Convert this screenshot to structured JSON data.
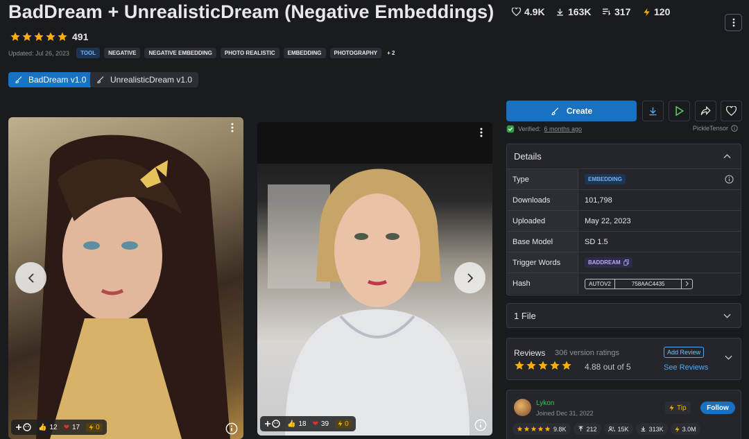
{
  "header": {
    "title": "BadDream + UnrealisticDream (Negative Embeddings)",
    "stats": [
      {
        "icon": "heart-icon",
        "value": "4.9K"
      },
      {
        "icon": "download-icon",
        "value": "163K"
      },
      {
        "icon": "bookmark-list-icon",
        "value": "317"
      },
      {
        "icon": "lightning-icon",
        "value": "120"
      }
    ],
    "rating_count": "491",
    "rating_stars": 5,
    "updated": "Updated: Jul 26, 2023",
    "tags": [
      "TOOL",
      "NEGATIVE",
      "NEGATIVE EMBEDDING",
      "PHOTO REALISTIC",
      "EMBEDDING",
      "PHOTOGRAPHY"
    ],
    "more_tags": "+ 2"
  },
  "versions": [
    {
      "label": "BadDream v1.0",
      "active": true
    },
    {
      "label": "UnrealisticDream v1.0",
      "active": false
    }
  ],
  "gallery": [
    {
      "likes": "12",
      "hearts": "17",
      "tips": "0"
    },
    {
      "likes": "18",
      "hearts": "39",
      "tips": "0"
    }
  ],
  "sidebar": {
    "create_label": "Create",
    "verified_prefix": "Verified:",
    "verified_when": "6 months ago",
    "author_tag": "PickleTensor",
    "details": {
      "title": "Details",
      "rows": [
        {
          "key": "Type",
          "value": "EMBEDDING"
        },
        {
          "key": "Downloads",
          "value": "101,798"
        },
        {
          "key": "Uploaded",
          "value": "May 22, 2023"
        },
        {
          "key": "Base Model",
          "value": "SD 1.5"
        },
        {
          "key": "Trigger Words",
          "value": "BADDREAM"
        },
        {
          "key": "Hash",
          "value": "758AAC4435",
          "hash_type": "AUTOV2"
        }
      ]
    },
    "files_label": "1 File",
    "reviews": {
      "title": "Reviews",
      "count": "306 version ratings",
      "average": "4.88 out of 5",
      "add_review": "Add Review",
      "see_reviews": "See Reviews"
    },
    "creator": {
      "name": "Lykon",
      "joined": "Joined Dec 31, 2022",
      "tip_label": "Tip",
      "follow_label": "Follow",
      "stats": [
        {
          "icon": "star-icon",
          "value": "9.8K"
        },
        {
          "icon": "upload-icon",
          "value": "212"
        },
        {
          "icon": "users-icon",
          "value": "15K"
        },
        {
          "icon": "download-icon",
          "value": "313K"
        },
        {
          "icon": "lightning-icon",
          "value": "3.0M"
        }
      ]
    }
  },
  "colors": {
    "background": "#1a1b1e",
    "primary": "#1971c2",
    "star": "#fab005",
    "panel": "#25262b"
  }
}
